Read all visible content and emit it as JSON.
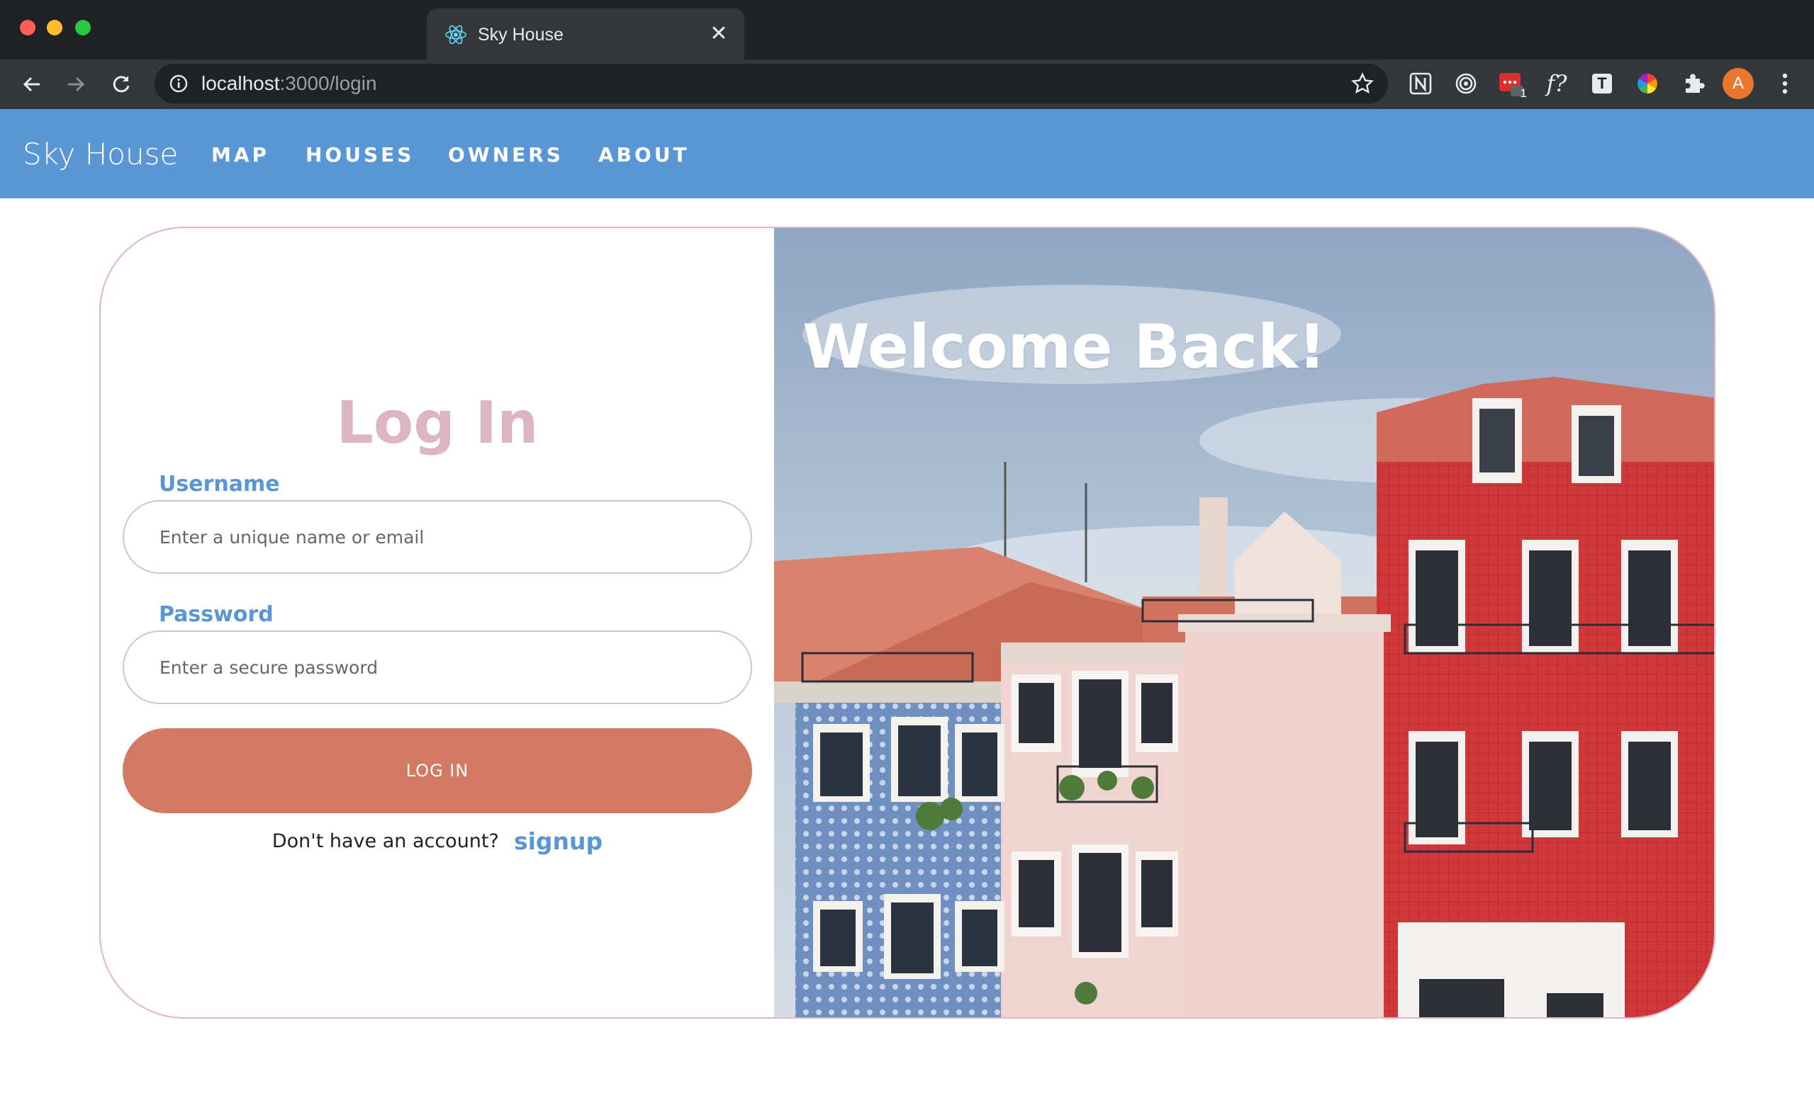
{
  "browser": {
    "tab_title": "Sky House",
    "tab_close": "✕",
    "url_host": "localhost",
    "url_path": ":3000/login",
    "profile_initial": "A",
    "extension_badge": "1",
    "ext_formula": "f?",
    "ext_t": "T"
  },
  "navbar": {
    "brand": "Sky House",
    "links": [
      "MAP",
      "HOUSES",
      "OWNERS",
      "ABOUT"
    ]
  },
  "login": {
    "title": "Log In",
    "username_label": "Username",
    "username_placeholder": "Enter a unique name or email",
    "password_label": "Password",
    "password_placeholder": "Enter a secure password",
    "submit_label": "LOG IN",
    "signup_prompt": "Don't have an account?",
    "signup_link": "signup"
  },
  "hero": {
    "welcome": "Welcome Back!"
  },
  "colors": {
    "navbar": "#5a95d6",
    "heading": "#dcb4c3",
    "button": "#d47a62",
    "card_border": "#e3b5c4"
  }
}
